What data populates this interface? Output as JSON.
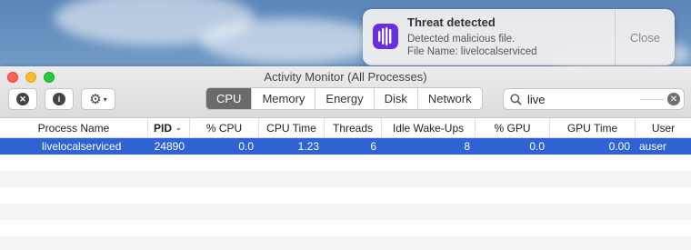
{
  "notification": {
    "title": "Threat detected",
    "line1": "Detected malicious file.",
    "line2": "File Name: livelocalserviced",
    "close_label": "Close",
    "icon": "shield-bars-icon",
    "icon_color": "#6b2fd6"
  },
  "window": {
    "title": "Activity Monitor (All Processes)",
    "toolbar": {
      "stop_icon": "x-circle-icon",
      "info_icon": "info-circle-icon",
      "gear_icon": "gear-icon",
      "tabs": [
        "CPU",
        "Memory",
        "Energy",
        "Disk",
        "Network"
      ],
      "active_tab": "CPU",
      "search_value": "live"
    }
  },
  "table": {
    "columns": [
      "Process Name",
      "PID",
      "% CPU",
      "CPU Time",
      "Threads",
      "Idle Wake-Ups",
      "% GPU",
      "GPU Time",
      "User"
    ],
    "sort_column": "PID",
    "rows": [
      {
        "name": "livelocalserviced",
        "pid": "24890",
        "cpu": "0.0",
        "cpu_time": "1.23",
        "threads": "6",
        "idle_wakeups": "8",
        "gpu": "0.0",
        "gpu_time": "0.00",
        "user": "auser"
      }
    ]
  },
  "colors": {
    "selection": "#2f62d3",
    "active_tab": "#6b6b6b"
  }
}
